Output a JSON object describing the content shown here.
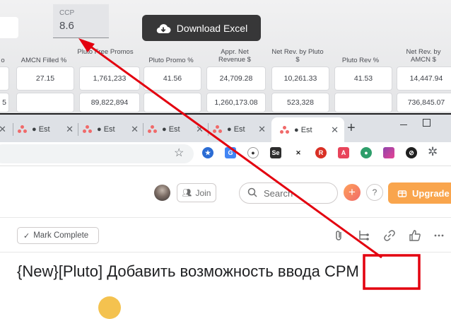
{
  "dashboard": {
    "ccp": {
      "label": "CCP",
      "value": "8.6"
    },
    "download_label": "Download Excel",
    "columns": [
      {
        "header": "o",
        "row1": "",
        "row2": "5"
      },
      {
        "header": "AMCN Filled  %",
        "row1": "27.15",
        "row2": ""
      },
      {
        "header": "Pluto Free Promos",
        "row1": "1,761,233",
        "row2": "89,822,894"
      },
      {
        "header": "Pluto Promo  %",
        "row1": "41.56",
        "row2": ""
      },
      {
        "header": "Appr. Net Revenue $",
        "row1": "24,709.28",
        "row2": "1,260,173.08"
      },
      {
        "header": "Net Rev. by Pluto  $",
        "row1": "10,261.33",
        "row2": "523,328"
      },
      {
        "header": "Pluto Rev %",
        "row1": "41.53",
        "row2": ""
      },
      {
        "header": "Net Rev. by AMCN $",
        "row1": "14,447.94",
        "row2": "736,845.07"
      }
    ]
  },
  "browser": {
    "tabs": [
      {
        "title": "Est"
      },
      {
        "title": "Est"
      },
      {
        "title": "Est"
      },
      {
        "title": "Est"
      }
    ],
    "active_tab": {
      "title": "Est"
    },
    "new_tab": "+",
    "extensions": [
      "Se",
      "A"
    ]
  },
  "asana": {
    "join_label": "Join",
    "search_placeholder": "Search",
    "help_label": "?",
    "upgrade_label": "Upgrade",
    "mark_complete_label": "Mark Complete",
    "task_title": "{New}[Pluto] Добавить возможность ввода CPM"
  },
  "colors": {
    "annotation_red": "#e3000f",
    "download_bg": "#373738",
    "upgrade_bg": "#f9a54d"
  }
}
